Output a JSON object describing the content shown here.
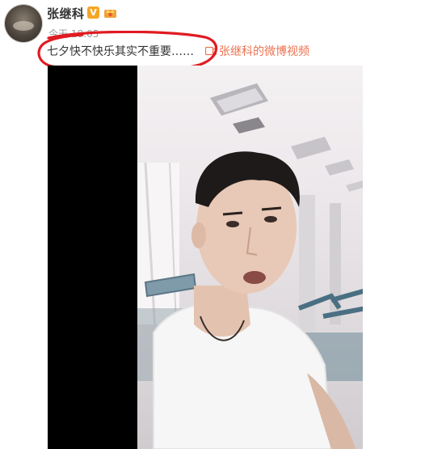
{
  "post": {
    "username": "张继科",
    "verified_badge": "V",
    "timestamp": "今天 18:05",
    "text": "七夕快不快乐其实不重要……",
    "video_link_label": "张继科的微博视频"
  },
  "colors": {
    "link": "#eb7350",
    "verified": "#f5a623",
    "highlight": "#e01b22",
    "video_bg": "#000000"
  },
  "icons": {
    "verified": "verified-icon",
    "member": "crown-icon",
    "video": "video-icon"
  }
}
